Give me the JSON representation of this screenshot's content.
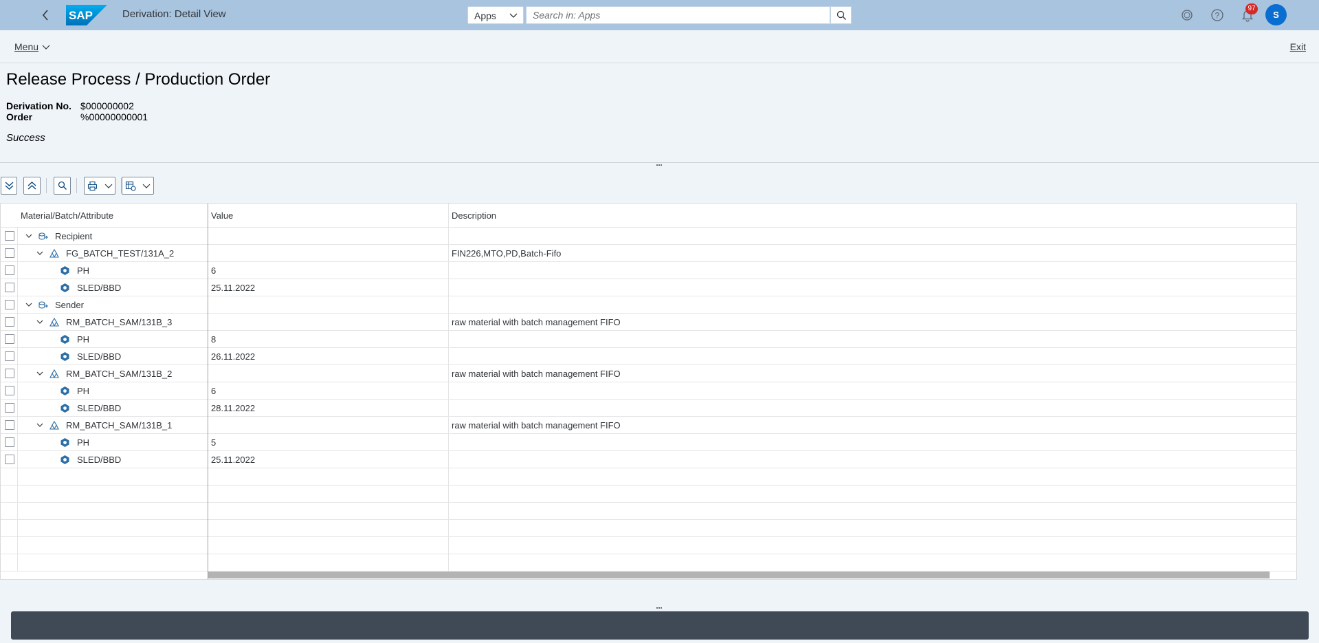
{
  "shell": {
    "title": "Derivation: Detail View",
    "logo_text": "SAP",
    "search_scope": "Apps",
    "search_placeholder": "Search in: Apps",
    "notification_count": "97",
    "avatar_initial": "S",
    "bar_color": "#a9c4df",
    "icons": [
      "back-icon",
      "search-icon",
      "copilot-icon",
      "help-icon",
      "bell-icon"
    ]
  },
  "subbar": {
    "menu_label": "Menu",
    "exit_label": "Exit"
  },
  "header": {
    "title": "Release Process / Production Order",
    "fields": [
      {
        "label": "Derivation No.",
        "value": "$000000002"
      },
      {
        "label": "Order",
        "value": "%00000000001"
      }
    ],
    "status": "Success"
  },
  "toolbar": {
    "icons": [
      "expand-all-icon",
      "collapse-all-icon",
      "find-icon",
      "print-icon",
      "layout-icon"
    ]
  },
  "table": {
    "columns": [
      "Material/Batch/Attribute",
      "Value",
      "Description"
    ],
    "rows": [
      {
        "level": 0,
        "type": "recipient",
        "name": "Recipient",
        "value": "",
        "desc": ""
      },
      {
        "level": 1,
        "type": "batch",
        "name": "FG_BATCH_TEST/131A_2",
        "value": "",
        "desc": "FIN226,MTO,PD,Batch-Fifo"
      },
      {
        "level": 2,
        "type": "attr",
        "name": "PH",
        "value": "6",
        "desc": ""
      },
      {
        "level": 2,
        "type": "attr",
        "name": "SLED/BBD",
        "value": "25.11.2022",
        "desc": ""
      },
      {
        "level": 0,
        "type": "sender",
        "name": "Sender",
        "value": "",
        "desc": ""
      },
      {
        "level": 1,
        "type": "batch",
        "name": "RM_BATCH_SAM/131B_3",
        "value": "",
        "desc": "raw material with batch management FIFO"
      },
      {
        "level": 2,
        "type": "attr",
        "name": "PH",
        "value": "8",
        "desc": ""
      },
      {
        "level": 2,
        "type": "attr",
        "name": "SLED/BBD",
        "value": "26.11.2022",
        "desc": ""
      },
      {
        "level": 1,
        "type": "batch",
        "name": "RM_BATCH_SAM/131B_2",
        "value": "",
        "desc": "raw material with batch management FIFO"
      },
      {
        "level": 2,
        "type": "attr",
        "name": "PH",
        "value": "6",
        "desc": ""
      },
      {
        "level": 2,
        "type": "attr",
        "name": "SLED/BBD",
        "value": "28.11.2022",
        "desc": ""
      },
      {
        "level": 1,
        "type": "batch",
        "name": "RM_BATCH_SAM/131B_1",
        "value": "",
        "desc": "raw material with batch management FIFO"
      },
      {
        "level": 2,
        "type": "attr",
        "name": "PH",
        "value": "5",
        "desc": ""
      },
      {
        "level": 2,
        "type": "attr",
        "name": "SLED/BBD",
        "value": "25.11.2022",
        "desc": ""
      }
    ],
    "empty_rows": 6
  }
}
